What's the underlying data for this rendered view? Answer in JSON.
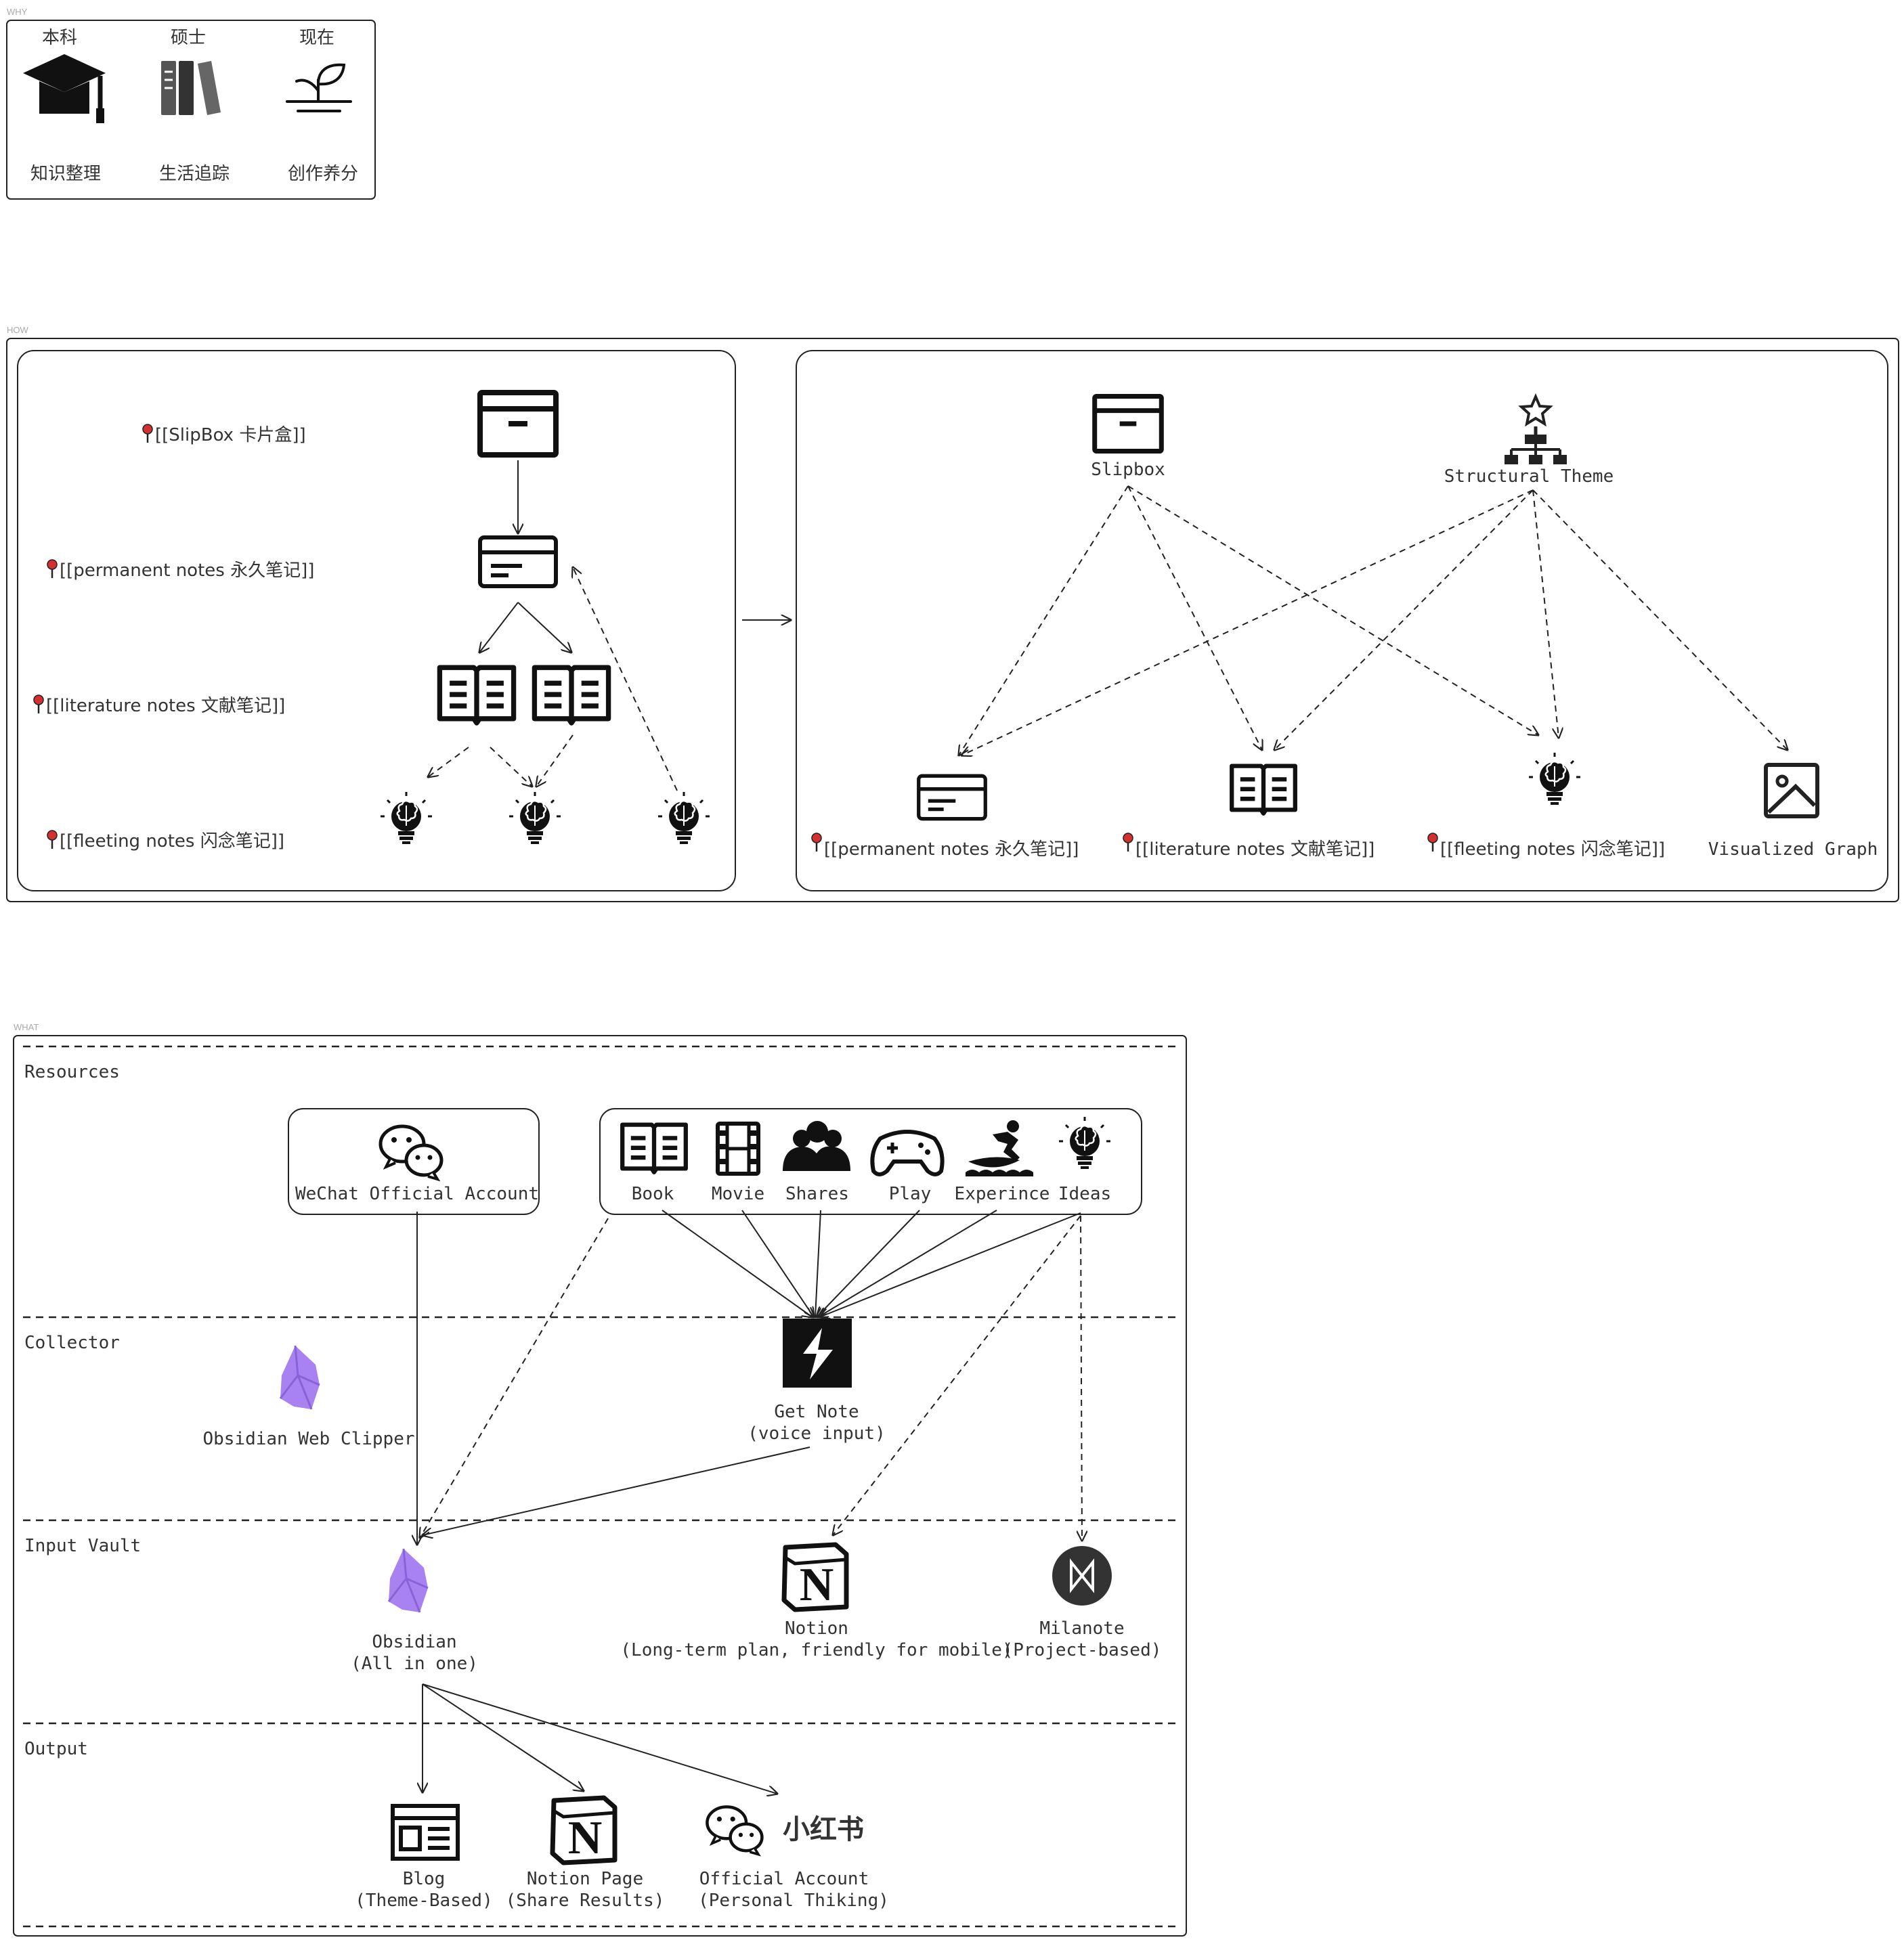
{
  "sections": {
    "why": "WHY",
    "how": "HOW",
    "what": "WHAT"
  },
  "why": {
    "stages": [
      {
        "top": "本科",
        "bottom": "知识整理",
        "icon": "graduation-cap-icon"
      },
      {
        "top": "硕士",
        "bottom": "生活追踪",
        "icon": "books-icon"
      },
      {
        "top": "现在",
        "bottom": "创作养分",
        "icon": "sprout-icon"
      }
    ]
  },
  "how": {
    "left": {
      "rows": [
        {
          "label": "[[SlipBox 卡片盒]]"
        },
        {
          "label": "[[permanent notes 永久笔记]]"
        },
        {
          "label": "[[literature notes 文献笔记]]"
        },
        {
          "label": "[[fleeting notes 闪念笔记]]"
        }
      ]
    },
    "right": {
      "slipbox": "Slipbox",
      "structural_theme": "Structural Theme",
      "targets": [
        "[[permanent notes 永久笔记]]",
        "[[literature notes 文献笔记]]",
        "[[fleeting notes 闪念笔记]]",
        "Visualized Graph"
      ]
    }
  },
  "what": {
    "lanes": [
      "Resources",
      "Collector",
      "Input Vault",
      "Output"
    ],
    "resources": {
      "wechat": "WeChat Official Account",
      "items": [
        "Book",
        "Movie",
        "Shares",
        "Play",
        "Experince",
        "Ideas"
      ]
    },
    "collector": {
      "clipper": "Obsidian Web Clipper",
      "getnote_1": "Get Note",
      "getnote_2": "(voice input)"
    },
    "vault": {
      "obsidian_1": "Obsidian",
      "obsidian_2": "(All in one)",
      "notion_1": "Notion",
      "notion_2": "(Long-term plan, friendly for mobile)",
      "milanote_1": "Milanote",
      "milanote_2": "(Project-based)"
    },
    "output": {
      "blog_1": "Blog",
      "blog_2": "(Theme-Based)",
      "notion_1": "Notion Page",
      "notion_2": "(Share Results)",
      "official_1": "Official Account",
      "official_2": "(Personal Thiking)",
      "xhs": "小红书"
    }
  },
  "colors": {
    "ink": "#222222",
    "obsidian": "#a882f0",
    "pin": "#d33030"
  }
}
